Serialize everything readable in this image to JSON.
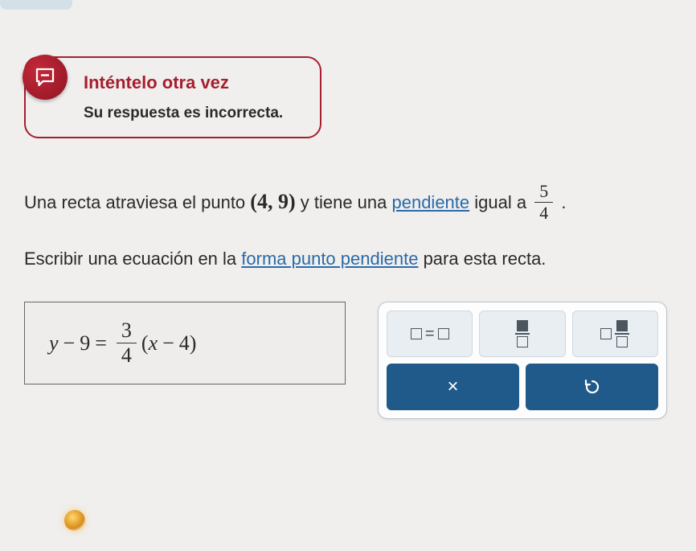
{
  "feedback": {
    "title": "Inténtelo otra vez",
    "subtitle": "Su respuesta es incorrecta."
  },
  "problem": {
    "pre": "Una recta atraviesa el punto ",
    "point": "(4, 9)",
    "mid": " y tiene una ",
    "slope_link": "pendiente",
    "post": " igual a ",
    "slope_num": "5",
    "slope_den": "4",
    "period": "."
  },
  "task": {
    "pre": "Escribir una ecuación en la ",
    "form_link": "forma punto pendiente",
    "post": " para esta recta."
  },
  "answer": {
    "y_var": "y",
    "minus1": "−",
    "y0": "9",
    "eq": "=",
    "frac_num": "3",
    "frac_den": "4",
    "lparen": "(",
    "x_var": "x",
    "minus2": "−",
    "x0": "4",
    "rparen": ")"
  },
  "keypad": {
    "equals": "=",
    "clear": "×",
    "reset": "↺"
  }
}
